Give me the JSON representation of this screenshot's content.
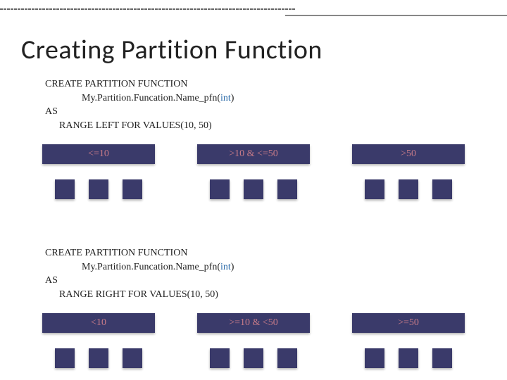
{
  "title": "Creating Partition Function",
  "code_left": {
    "line1": "CREATE PARTITION FUNCTION",
    "line2_pre": "My.Partition.Funcation.Name_pfn(",
    "line2_int": "int",
    "line2_post": ")",
    "line3": "AS",
    "line4": "RANGE LEFT FOR VALUES(10, 50)"
  },
  "code_right": {
    "line1": "CREATE PARTITION FUNCTION",
    "line2_pre": "My.Partition.Funcation.Name_pfn(",
    "line2_int": "int",
    "line2_post": ")",
    "line3": "AS",
    "line4": "RANGE RIGHT FOR VALUES(10, 50)"
  },
  "ranges_left": {
    "r1": "<=10",
    "r2": ">10 & <=50",
    "r3": ">50"
  },
  "ranges_right": {
    "r1": "<10",
    "r2": ">=10 & <50",
    "r3": ">=50"
  }
}
